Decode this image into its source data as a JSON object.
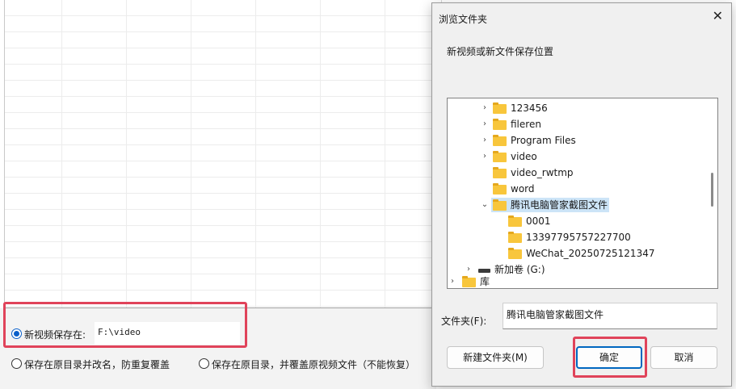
{
  "options": {
    "save_new_label": "新视频保存在:",
    "save_path": "F:\\video",
    "rename_label": "保存在原目录并改名，防重复覆盖",
    "overwrite_label": "保存在原目录，并覆盖原视频文件（不能恢复）"
  },
  "dialog": {
    "title": "浏览文件夹",
    "close_glyph": "✕",
    "description": "新视频或新文件保存位置",
    "tree": [
      {
        "label": "123456",
        "expander": "›"
      },
      {
        "label": "fileren",
        "expander": "›"
      },
      {
        "label": "Program Files",
        "expander": "›"
      },
      {
        "label": "video",
        "expander": "›"
      },
      {
        "label": "video_rwtmp",
        "expander": ""
      },
      {
        "label": "word",
        "expander": ""
      },
      {
        "label": "腾讯电脑管家截图文件",
        "expander": "⌄",
        "selected": true
      },
      {
        "label": "0001",
        "expander": ""
      },
      {
        "label": "13397795757227700",
        "expander": ""
      },
      {
        "label": "WeChat_20250725121347",
        "expander": ""
      },
      {
        "label": "新加卷 (G:)",
        "expander": "›",
        "icon": "drive-icon"
      },
      {
        "label": "库",
        "expander": "›"
      }
    ],
    "folder_label": "文件夹(F):",
    "folder_value": "腾讯电脑管家截图文件",
    "new_folder_button": "新建文件夹(M)",
    "ok_button": "确定",
    "cancel_button": "取消"
  },
  "colors": {
    "highlight_box": "#e0435a",
    "accent": "#0067c0",
    "folder": "#f8c63c",
    "selection": "#cce4f7"
  }
}
